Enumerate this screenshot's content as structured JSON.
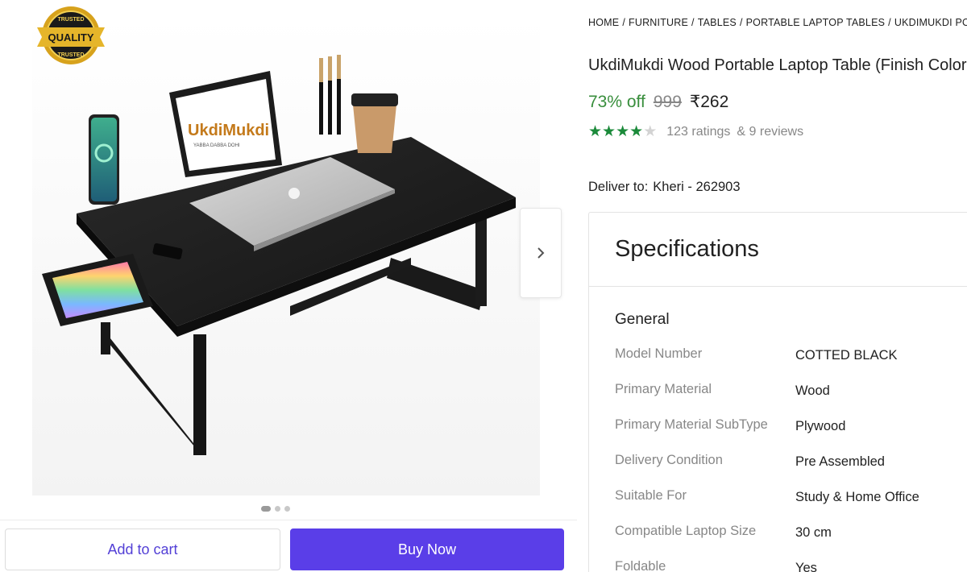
{
  "gallery": {
    "badge_top_text": "TRUSTED",
    "badge_main_text": "QUALITY",
    "badge_bottom_text": "TRUSTED",
    "brand_logo_text": "UkdiMukdi",
    "brand_tagline": "YABBA DABBA DOHI",
    "next_icon": "chevron-right-icon",
    "current_image": 1,
    "image_count": 3
  },
  "actions": {
    "add_to_cart": "Add to cart",
    "buy_now": "Buy Now"
  },
  "breadcrumb": [
    "HOME",
    "FURNITURE",
    "TABLES",
    "PORTABLE LAPTOP TABLES",
    "UKDIMUKDI PORTABLE LAPTOP TABLES"
  ],
  "product": {
    "title": "UkdiMukdi Wood Portable Laptop Table (Finish Color - Cotted Black)",
    "discount": "73% off",
    "mrp": "999",
    "price": "₹262",
    "rating_value": 4,
    "rating_max": 5,
    "ratings_text": "123 ratings",
    "reviews_text": "& 9 reviews"
  },
  "delivery": {
    "label": "Deliver to:",
    "location": "Kheri - 262903"
  },
  "specs": {
    "title": "Specifications",
    "section": "General",
    "rows": [
      {
        "key": "Model Number",
        "value": "COTTED BLACK"
      },
      {
        "key": "Primary Material",
        "value": "Wood"
      },
      {
        "key": "Primary Material SubType",
        "value": "Plywood"
      },
      {
        "key": "Delivery Condition",
        "value": "Pre Assembled"
      },
      {
        "key": "Suitable For",
        "value": "Study & Home Office"
      },
      {
        "key": "Compatible Laptop Size",
        "value": "30 cm"
      },
      {
        "key": "Foldable",
        "value": "Yes"
      }
    ]
  },
  "colors": {
    "accent": "#5a3ee8",
    "discount_green": "#388e3c",
    "star_green": "#1b8a3a",
    "muted": "#878787"
  }
}
